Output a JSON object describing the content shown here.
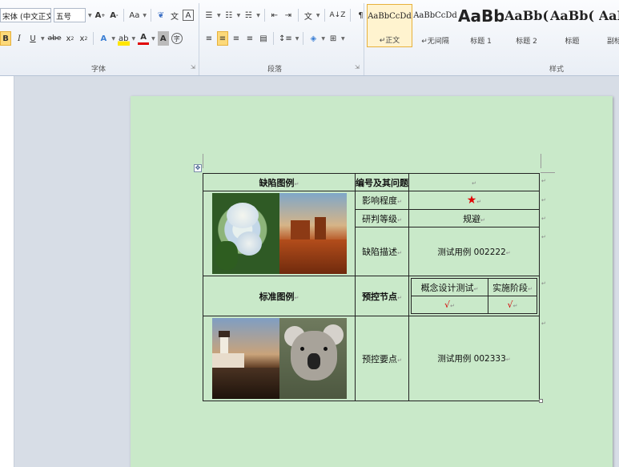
{
  "ribbon": {
    "font": {
      "font_name": "宋体 (中文正文)",
      "font_size": "五号",
      "group_label": "字体"
    },
    "paragraph": {
      "group_label": "段落"
    },
    "styles": {
      "group_label": "样式",
      "items": [
        {
          "preview": "AaBbCcDd",
          "name": "正文"
        },
        {
          "preview": "AaBbCcDd",
          "name": "无间隔"
        },
        {
          "preview": "AaBb",
          "name": "标题 1"
        },
        {
          "preview": "AaBb(",
          "name": "标题 2"
        },
        {
          "preview": "AaBb(",
          "name": "标题"
        },
        {
          "preview": "AaBb",
          "name": "副标题"
        }
      ]
    }
  },
  "table": {
    "header_left": "缺陷图例",
    "header_mid": "编号及其问题",
    "impact_label": "影响程度",
    "impact_value": "★",
    "judge_label": "研判等级",
    "judge_value": "规避",
    "desc_label": "缺陷描述",
    "desc_value": "测试用例 002222",
    "std_label": "标准图例",
    "node_label": "预控节点",
    "node_col1": "概念设计测试",
    "node_col2": "实施阶段",
    "node_val1": "√",
    "node_val2": "√",
    "key_label": "预控要点",
    "key_value": "测试用例 002333",
    "para_mark": "↵"
  }
}
